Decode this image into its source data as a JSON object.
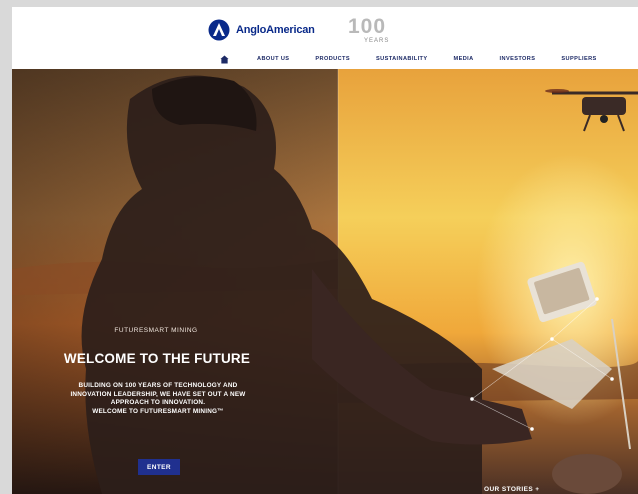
{
  "brand": {
    "logo_text": "AngloAmerican",
    "centenary_number": "100",
    "centenary_caption": "YEARS"
  },
  "nav": {
    "home_icon": "home-icon",
    "items": [
      "ABOUT US",
      "PRODUCTS",
      "SUSTAINABILITY",
      "MEDIA",
      "INVESTORS",
      "SUPPLIERS"
    ]
  },
  "hero": {
    "eyebrow": "FUTURESMART MINING",
    "headline": "WELCOME TO THE FUTURE",
    "body_lines": [
      "BUILDING ON 100 YEARS OF TECHNOLOGY AND",
      "INNOVATION LEADERSHIP, WE HAVE SET OUT A NEW",
      "APPROACH TO INNOVATION.",
      "WELCOME TO FUTURESMART MINING™"
    ],
    "enter_label": "ENTER",
    "stories_label": "OUR STORIES  +"
  },
  "colors": {
    "brand_blue": "#0a2a8a",
    "button_blue": "#20308f",
    "sunset_orange": "#e8952f",
    "sky_yellow": "#f5d15d"
  }
}
